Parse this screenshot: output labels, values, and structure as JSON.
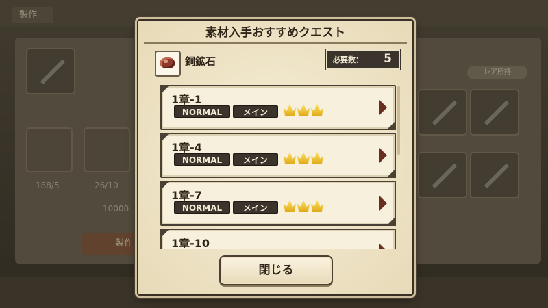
{
  "dialog": {
    "title": "素材入手おすすめクエスト",
    "material": {
      "icon": "ore-icon",
      "name": "銅鉱石",
      "required_label": "必要数：",
      "required_value": "5"
    },
    "quests": [
      {
        "title": "1章-1",
        "difficulty": "NORMAL",
        "type": "メイン",
        "crowns": 3
      },
      {
        "title": "1章-4",
        "difficulty": "NORMAL",
        "type": "メイン",
        "crowns": 3
      },
      {
        "title": "1章-7",
        "difficulty": "NORMAL",
        "type": "メイン",
        "crowns": 3
      },
      {
        "title": "1章-10"
      }
    ],
    "close_label": "閉じる"
  },
  "background": {
    "tab_label": "製作",
    "stat_1": "188/5",
    "stat_2": "26/10",
    "gold": "10000",
    "craft_label": "製作",
    "rare_button": "レア所持"
  },
  "colors": {
    "panel": "#f0e6c8",
    "tag_bg": "#3a342c",
    "crown": "#f2c230",
    "arrow": "#6a2e1e"
  }
}
